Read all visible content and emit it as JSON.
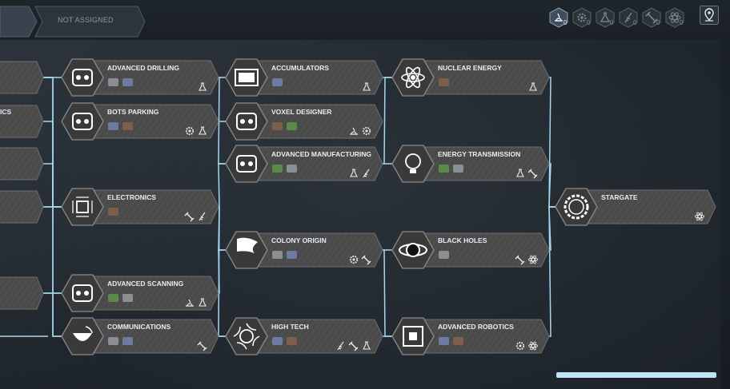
{
  "header": {
    "assignment_label": "NOT ASSIGNED",
    "filters": [
      {
        "icon": "scanning-filter-icon",
        "count": "0",
        "active": true
      },
      {
        "icon": "gear-filter-icon",
        "count": "0",
        "active": false
      },
      {
        "icon": "flask-filter-icon",
        "count": "0",
        "active": false
      },
      {
        "icon": "drill-filter-icon",
        "count": "0",
        "active": false
      },
      {
        "icon": "satellite-filter-icon",
        "count": "0",
        "active": false
      },
      {
        "icon": "atom-filter-icon",
        "count": "0",
        "active": false
      }
    ],
    "location_button_icon": "map-pin-icon"
  },
  "tree": {
    "partial_nodes": [
      {
        "label": "ICS"
      }
    ],
    "columns": [
      [
        {
          "id": "advanced-drilling",
          "title": "ADVANCED DRILLING",
          "icon": "drill-rig-icon",
          "badges": [
            "flask"
          ]
        },
        {
          "id": "bots-parking",
          "title": "BOTS PARKING",
          "icon": "bots-icon",
          "badges": [
            "gear",
            "flask"
          ]
        },
        {
          "id": "electronics",
          "title": "ELECTRONICS",
          "icon": "circuit-chip-icon",
          "badges": [
            "satellite",
            "drill"
          ]
        },
        {
          "id": "advanced-scanning",
          "title": "ADVANCED SCANNING",
          "icon": "scanner-icon",
          "badges": [
            "scan",
            "flask"
          ]
        },
        {
          "id": "communications",
          "title": "COMMUNICATIONS",
          "icon": "dish-antenna-icon",
          "badges": [
            "satellite"
          ]
        }
      ],
      [
        {
          "id": "accumulators",
          "title": "ACCUMULATORS",
          "icon": "battery-icon",
          "badges": [
            "flask"
          ]
        },
        {
          "id": "voxel-designer",
          "title": "VOXEL DESIGNER",
          "icon": "drafting-icon",
          "badges": [
            "scan",
            "gear"
          ]
        },
        {
          "id": "advanced-manufacturing",
          "title": "ADVANCED MANUFACTURING",
          "icon": "factory-icon",
          "badges": [
            "flask",
            "drill"
          ]
        },
        {
          "id": "colony-origin",
          "title": "COLONY ORIGIN",
          "icon": "flag-icon",
          "badges": [
            "gear",
            "satellite"
          ]
        },
        {
          "id": "high-tech",
          "title": "HIGH TECH",
          "icon": "globe-swirl-icon",
          "badges": [
            "drill",
            "satellite",
            "flask"
          ]
        }
      ],
      [
        {
          "id": "nuclear-energy",
          "title": "NUCLEAR ENERGY",
          "icon": "atom-icon",
          "badges": [
            "flask"
          ]
        },
        {
          "id": "energy-transmission",
          "title": "ENERGY TRANSMISSION",
          "icon": "lightbulb-icon",
          "badges": [
            "flask",
            "satellite"
          ]
        },
        {
          "id": "black-holes",
          "title": "BLACK HOLES",
          "icon": "black-hole-icon",
          "badges": [
            "satellite",
            "atom"
          ]
        },
        {
          "id": "advanced-robotics",
          "title": "ADVANCED ROBOTICS",
          "icon": "robot-cube-icon",
          "badges": [
            "gear",
            "atom"
          ]
        }
      ],
      [
        {
          "id": "stargate",
          "title": "STARGATE",
          "icon": "stargate-ring-icon",
          "badges": [
            "atom"
          ]
        }
      ]
    ]
  },
  "colors": {
    "link_line": "#a8d8f0",
    "node_fill": "#4a4a4a",
    "node_border": "#6e6e6e",
    "title_text": "#e9ecef",
    "filter_active": "#3f4e5e",
    "scrollbar": "#bfe4f5"
  }
}
